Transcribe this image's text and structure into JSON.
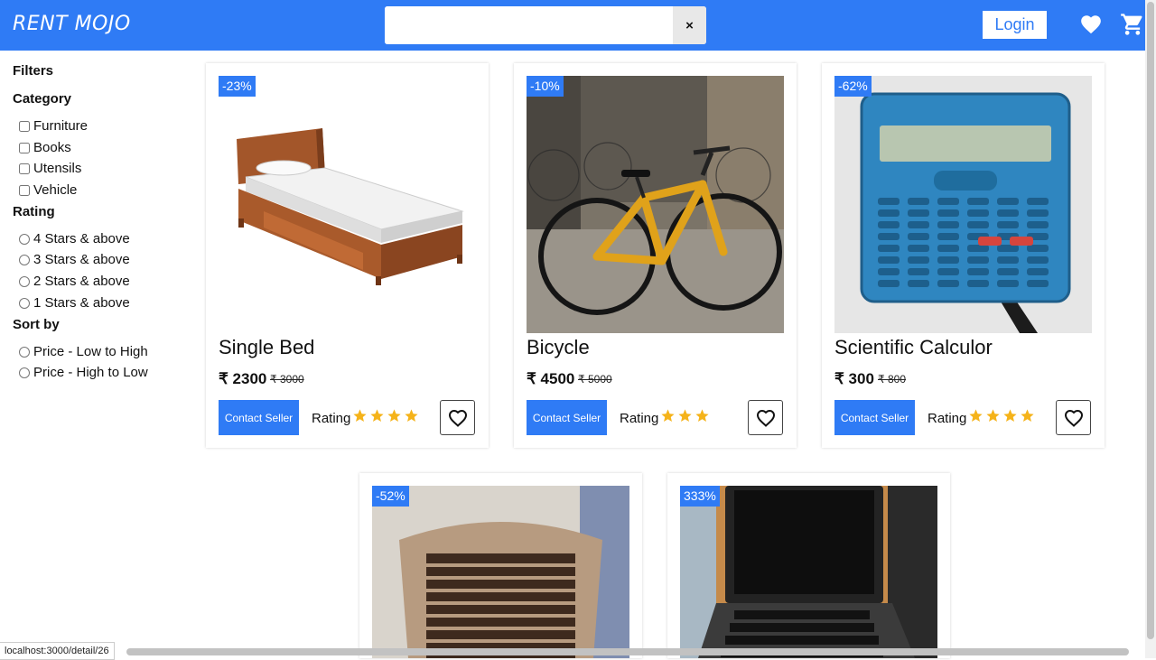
{
  "header": {
    "brand": "RENT MOJO",
    "search": {
      "value": "",
      "placeholder": ""
    },
    "clear_label": "×",
    "login_label": "Login",
    "wishlist_icon": "heart-icon",
    "cart_icon": "cart-icon"
  },
  "filters": {
    "title": "Filters",
    "category": {
      "title": "Category",
      "options": [
        "Furniture",
        "Books",
        "Utensils",
        "Vehicle"
      ]
    },
    "rating": {
      "title": "Rating",
      "options": [
        "4 Stars & above",
        "3 Stars & above",
        "2 Stars & above",
        "1 Stars & above"
      ]
    },
    "sort": {
      "title": "Sort by",
      "options": [
        "Price - Low to High",
        "Price - High to Low"
      ]
    }
  },
  "products": [
    {
      "badge": "-23%",
      "title": "Single Bed",
      "price": "₹ 2300",
      "old_price": "₹ 3000",
      "contact_label": "Contact Seller",
      "rating_label": "Rating",
      "stars": 4
    },
    {
      "badge": "-10%",
      "title": "Bicycle",
      "price": "₹ 4500",
      "old_price": "₹ 5000",
      "contact_label": "Contact Seller",
      "rating_label": "Rating",
      "stars": 3
    },
    {
      "badge": "-62%",
      "title": "Scientific Calculor",
      "price": "₹ 300",
      "old_price": "₹ 800",
      "contact_label": "Contact Seller",
      "rating_label": "Rating",
      "stars": 4
    },
    {
      "badge": "-52%"
    },
    {
      "badge": "333%"
    }
  ],
  "status_url": "localhost:3000/detail/26",
  "colors": {
    "primary": "#2f7bf5",
    "star": "#f5b31a"
  }
}
